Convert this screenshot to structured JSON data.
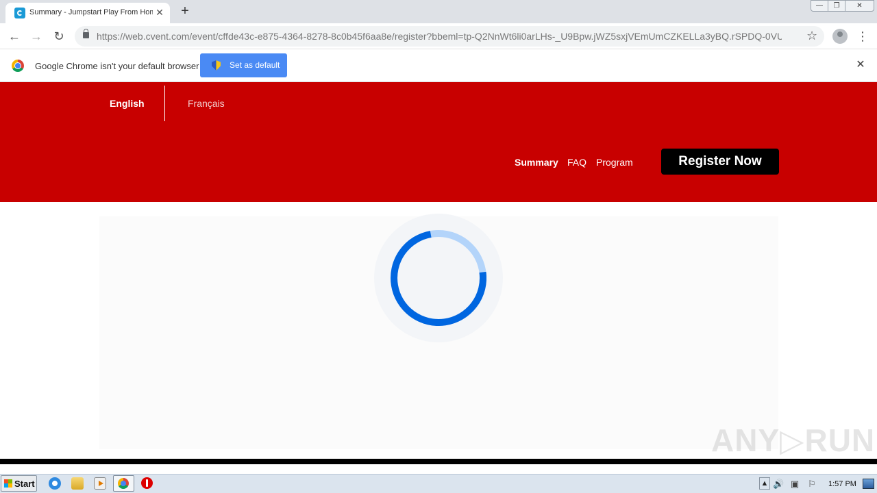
{
  "browser": {
    "tab_title": "Summary - Jumpstart Play From Hom",
    "tab_close": "✕",
    "new_tab": "+",
    "window_min": "—",
    "window_max": "❐",
    "window_close": "✕",
    "url": "https://web.cvent.com/event/cffde43c-e875-4364-8278-8c0b45f6aa8e/register?bbeml=tp-Q2NnWt6li0arLHs-_U9Bpw.jWZ5sxjVEmUmCZKELLa3yBQ.rSPDQ-0VU5...",
    "back_icon": "←",
    "forward_icon": "→",
    "reload_icon": "↻",
    "star_icon": "☆",
    "menu_icon": "⋮"
  },
  "infobar": {
    "message": "Google Chrome isn't your default browser",
    "button_label": "Set as default",
    "close_icon": "✕"
  },
  "header": {
    "languages": [
      "English",
      "Français"
    ],
    "nav": [
      "Summary",
      "FAQ",
      "Program"
    ],
    "register_label": "Register Now",
    "brand_color": "#c80000"
  },
  "content": {
    "spinner_color": "#0066e0",
    "spinner_track_color": "#b3d4fa"
  },
  "watermark": {
    "text": "ANY▷RUN"
  },
  "taskbar": {
    "start_label": "Start",
    "tray_arrow": "▲",
    "speaker_icon": "🔊",
    "network_icon": "▣",
    "flag_icon": "⚐",
    "clock": "1:57 PM"
  }
}
